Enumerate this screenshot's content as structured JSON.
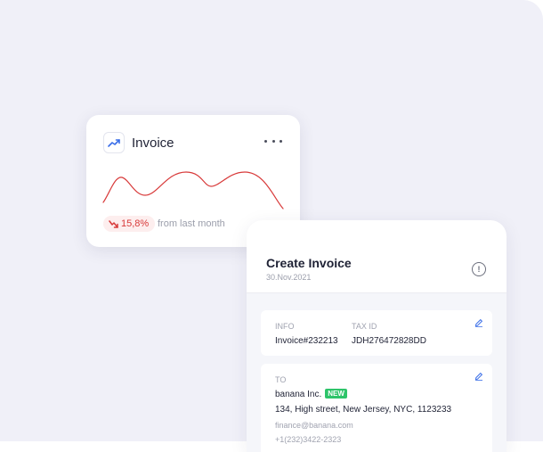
{
  "widget": {
    "title": "Invoice",
    "change": "15,8%",
    "change_caption": "from last month",
    "icons": {
      "trend": "trending-up-icon",
      "more": "more-horizontal-icon",
      "down": "trending-down-icon"
    },
    "colors": {
      "accent": "#3a6ee8",
      "line": "#d83a3a"
    }
  },
  "panel": {
    "title": "Create Invoice",
    "date": "30.Nov.2021",
    "alert_glyph": "!",
    "info": {
      "info_label": "INFO",
      "info_value": "Invoice#232213",
      "tax_label": "TAX ID",
      "tax_value": "JDH276472828DD"
    },
    "to": {
      "label": "TO",
      "company": "banana Inc.",
      "badge": "NEW",
      "address": "134, High street, New Jersey, NYC, 1123233",
      "email": "finance@banana.com",
      "phone": "+1(232)3422-2323"
    }
  }
}
